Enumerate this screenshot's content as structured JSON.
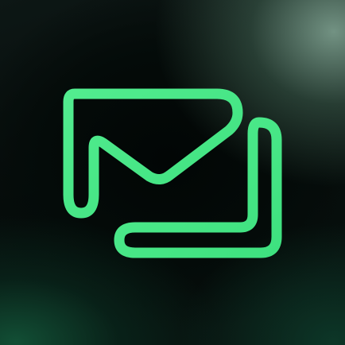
{
  "icon": {
    "name": "mail-forward-logo",
    "stroke_color": "#3ee17f",
    "stroke_color_light": "#52ec8f"
  }
}
